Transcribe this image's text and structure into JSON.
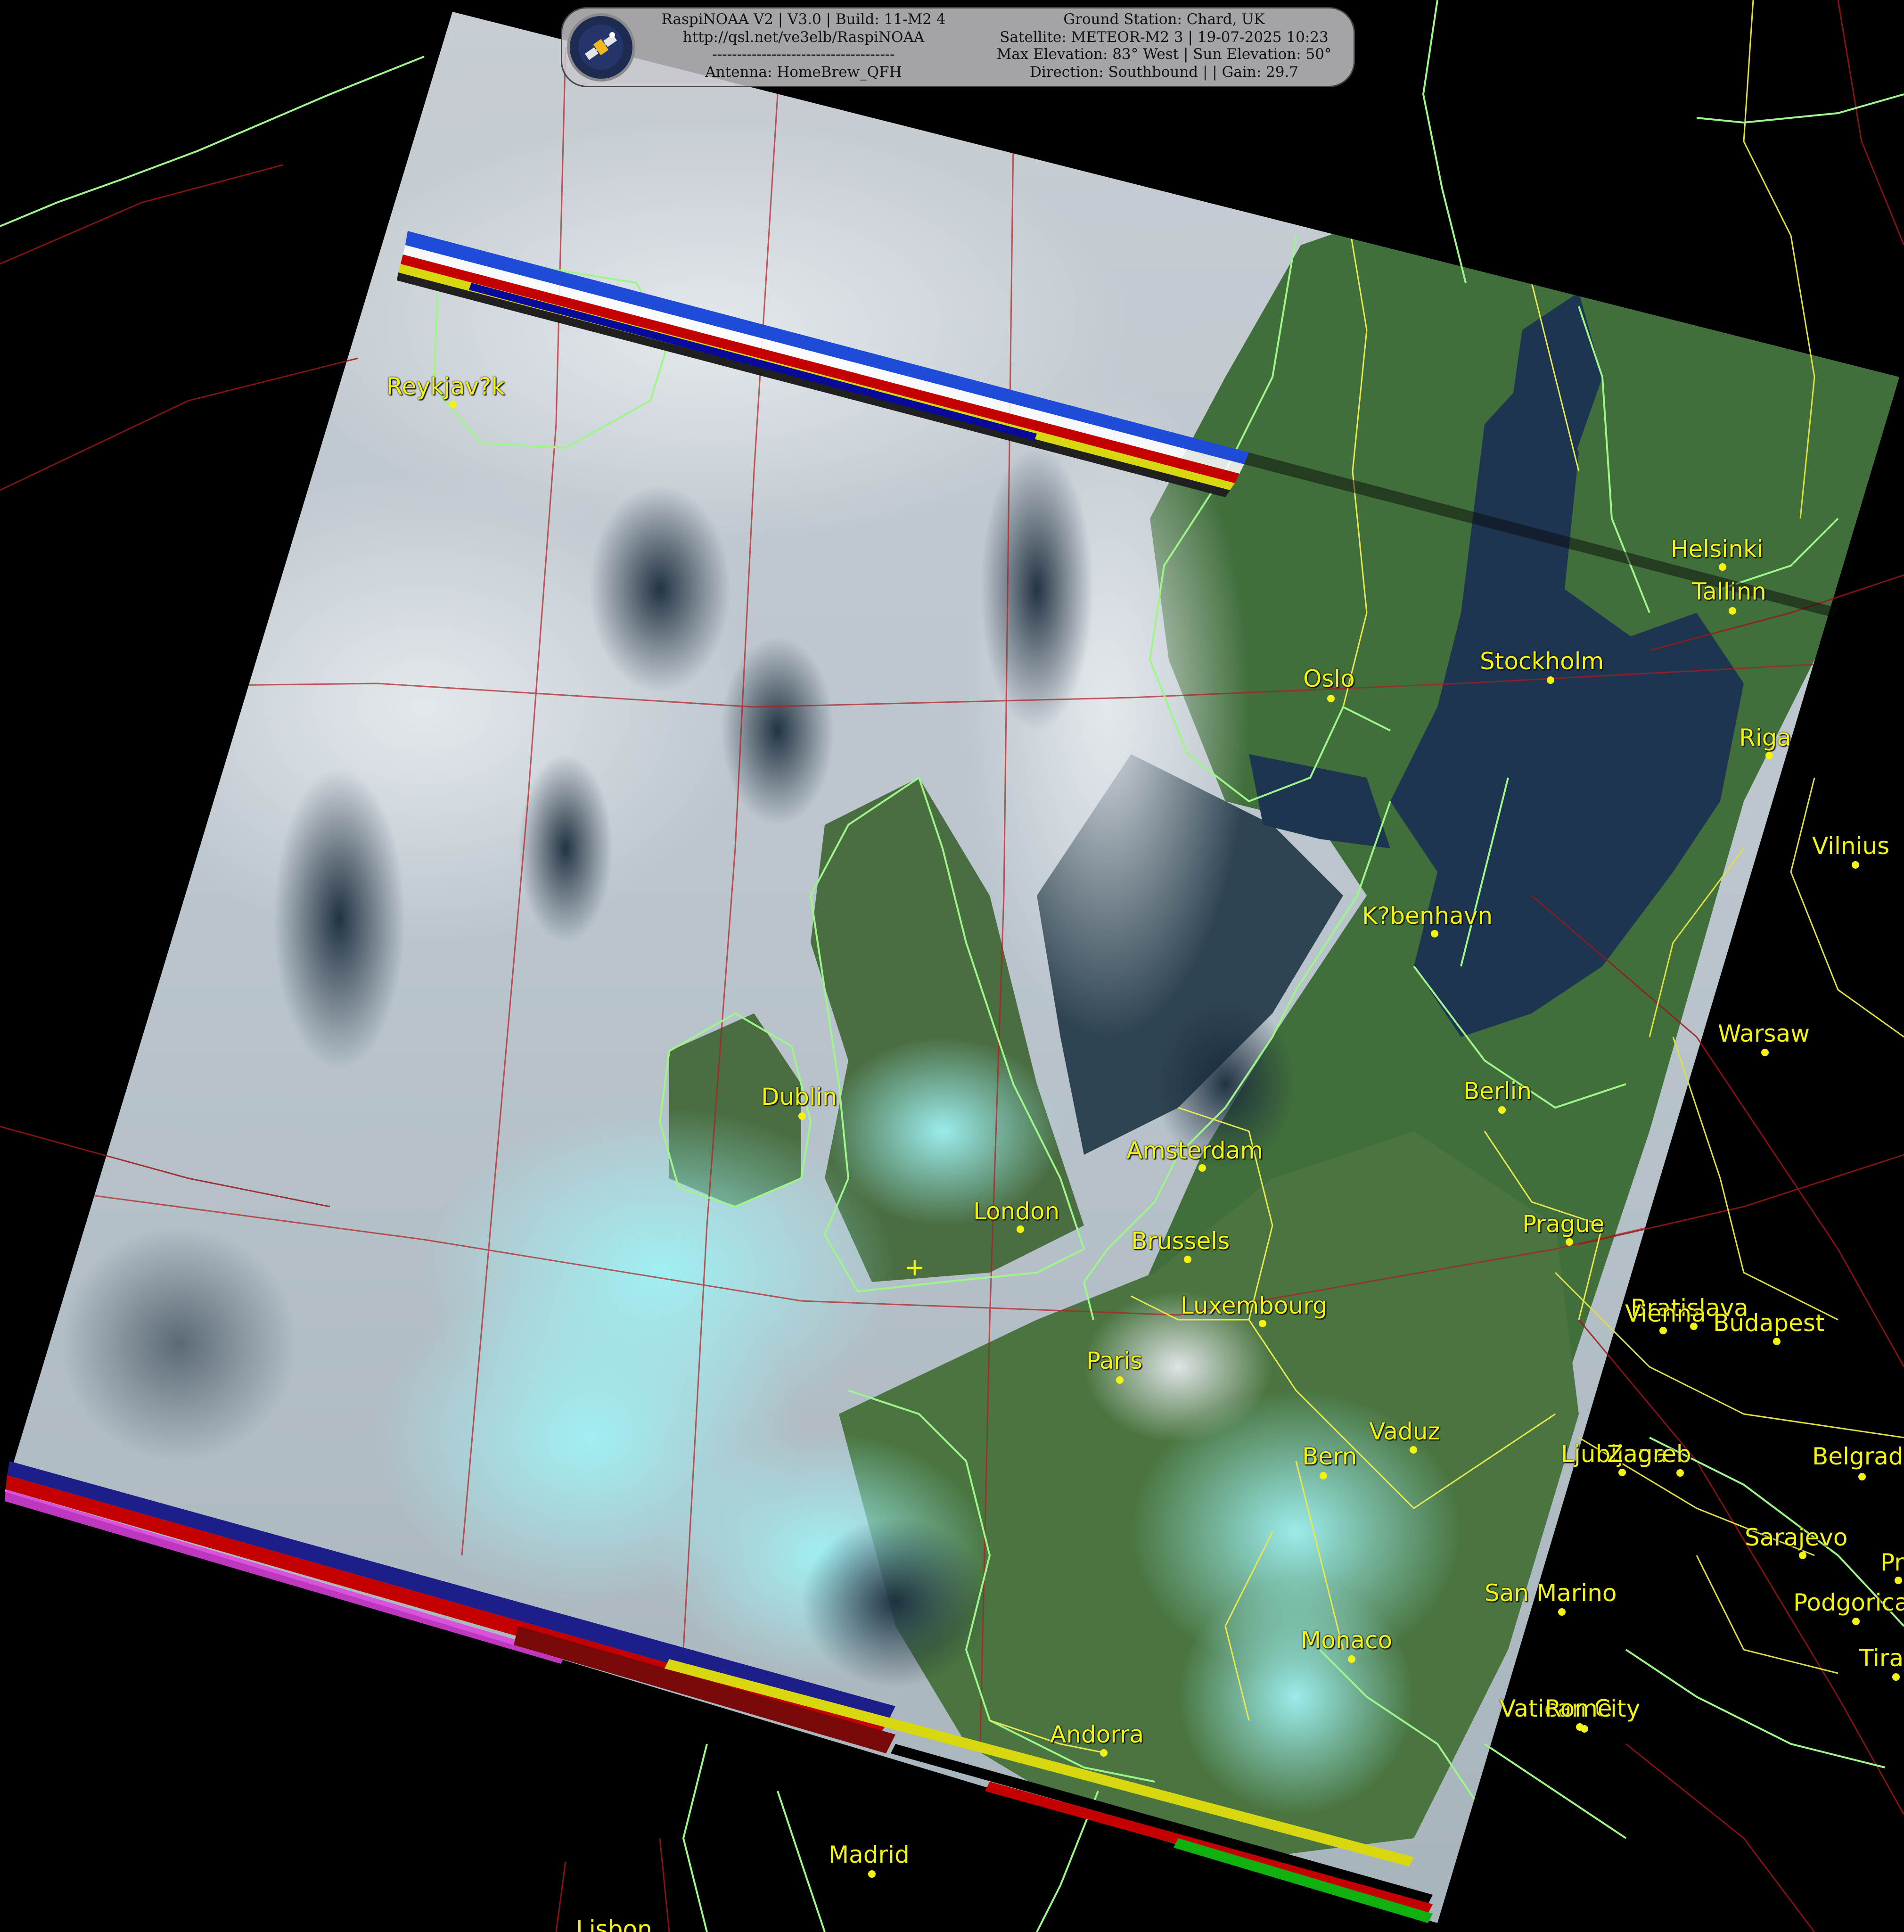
{
  "header": {
    "line1_left": "RaspiNOAA V2 | V3.0 | Build: 11-M2 4",
    "line2_left": "http://qsl.net/ve3elb/RaspiNOAA",
    "line3_left": "-------------------------------------",
    "line4_left": "Antenna: HomeBrew_QFH",
    "line1_right": "Ground Station: Chard, UK",
    "line2_right": "Satellite: METEOR-M2 3 | 19-07-2025 10:23",
    "line3_right": "Max Elevation: 83° West | Sun Elevation: 50°",
    "line4_right": "Direction: Southbound | | Gain: 29.7"
  },
  "logo_icon": "satellite-icon",
  "station_marker": "+",
  "cities": [
    {
      "id": "reykjavik",
      "label": "Reykjav?k"
    },
    {
      "id": "helsinki",
      "label": "Helsinki"
    },
    {
      "id": "tallinn",
      "label": "Tallinn"
    },
    {
      "id": "oslo",
      "label": "Oslo"
    },
    {
      "id": "stockholm",
      "label": "Stockholm"
    },
    {
      "id": "riga",
      "label": "Riga"
    },
    {
      "id": "vilnius",
      "label": "Vilnius"
    },
    {
      "id": "kobenhavn",
      "label": "K?benhavn"
    },
    {
      "id": "warsaw",
      "label": "Warsaw"
    },
    {
      "id": "dublin",
      "label": "Dublin"
    },
    {
      "id": "berlin",
      "label": "Berlin"
    },
    {
      "id": "amsterdam",
      "label": "Amsterdam"
    },
    {
      "id": "london",
      "label": "London"
    },
    {
      "id": "prague",
      "label": "Prague"
    },
    {
      "id": "brussels",
      "label": "Brussels"
    },
    {
      "id": "luxembourg",
      "label": "Luxembourg"
    },
    {
      "id": "bratislava",
      "label": "Bratislava"
    },
    {
      "id": "vienna",
      "label": "Vienna"
    },
    {
      "id": "budapest",
      "label": "Budapest"
    },
    {
      "id": "paris",
      "label": "Paris"
    },
    {
      "id": "vaduz",
      "label": "Vaduz"
    },
    {
      "id": "bern",
      "label": "Bern"
    },
    {
      "id": "ljubljana",
      "label": "Ljubljana"
    },
    {
      "id": "zagreb",
      "label": "Zagreb"
    },
    {
      "id": "belgrade",
      "label": "Belgrade"
    },
    {
      "id": "sarajevo",
      "label": "Sarajevo"
    },
    {
      "id": "pristina",
      "label": "Pristina"
    },
    {
      "id": "podgorica",
      "label": "Podgorica"
    },
    {
      "id": "tirana",
      "label": "Tirana"
    },
    {
      "id": "sanmarino",
      "label": "San Marino"
    },
    {
      "id": "monaco",
      "label": "Monaco"
    },
    {
      "id": "vatican",
      "label": "Vatican City"
    },
    {
      "id": "rome",
      "label": "Rome"
    },
    {
      "id": "andorra",
      "label": "Andorra"
    },
    {
      "id": "madrid",
      "label": "Madrid"
    },
    {
      "id": "lisbon",
      "label": "Lisbon"
    }
  ],
  "colors": {
    "background": "#000000",
    "city_label": "#f2f213",
    "coastline": "#9ef58a",
    "border": "#e8e850",
    "graticule": "#b01c1c",
    "cloud": "#c9d3dc",
    "cyan_cloud": "#8fe7ec",
    "sea": "#1b2d3f",
    "land": "#3d6b3a"
  }
}
